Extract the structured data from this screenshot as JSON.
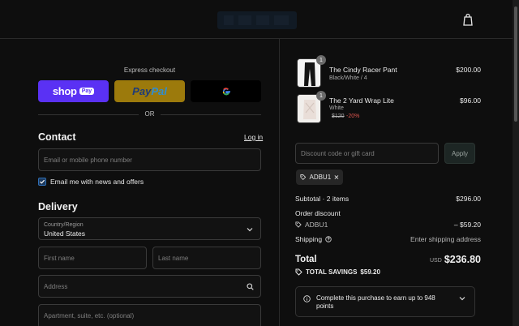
{
  "header": {
    "logo_icon": "brand-logo",
    "cart_icon": "shopping-bag-icon"
  },
  "express": {
    "label": "Express checkout",
    "shop_pay": {
      "text": "shop",
      "badge": "Pay"
    },
    "paypal": {
      "text_a": "Pay",
      "text_b": "Pal"
    },
    "google_icon": "google-icon",
    "or_label": "OR"
  },
  "contact": {
    "title": "Contact",
    "login_link": "Log in",
    "email_placeholder": "Email or mobile phone number",
    "newsletter_label": "Email me with news and offers",
    "newsletter_checked": true
  },
  "delivery": {
    "title": "Delivery",
    "country_label": "Country/Region",
    "country_value": "United States",
    "first_name_placeholder": "First name",
    "last_name_placeholder": "Last name",
    "address_placeholder": "Address",
    "apartment_placeholder": "Apartment, suite, etc. (optional)"
  },
  "cart": {
    "items": [
      {
        "name": "The Cindy Racer Pant",
        "variant": "Black/White / 4",
        "price": "$200.00",
        "qty": "1"
      },
      {
        "name": "The 2 Yard Wrap Lite",
        "variant": "White",
        "original_price": "$120",
        "discount": "-20%",
        "price": "$96.00",
        "qty": "1"
      }
    ]
  },
  "discount": {
    "placeholder": "Discount code or gift card",
    "apply_label": "Apply",
    "code": "ADBU1"
  },
  "summary": {
    "subtotal_label": "Subtotal · 2 items",
    "subtotal_value": "$296.00",
    "order_discount_label": "Order discount",
    "discount_code": "ADBU1",
    "discount_value": "– $59.20",
    "shipping_label": "Shipping",
    "shipping_value": "Enter shipping address",
    "total_label": "Total",
    "currency": "USD",
    "total_value": "$236.80",
    "savings_label": "TOTAL SAVINGS",
    "savings_value": "$59.20"
  },
  "points": {
    "text": "Complete this purchase to earn up to 948 points"
  },
  "colors": {
    "shop_pay": "#5a31f4",
    "paypal": "#9c7a0c",
    "background": "#0e0e0e",
    "discount_red": "#e0564f"
  }
}
